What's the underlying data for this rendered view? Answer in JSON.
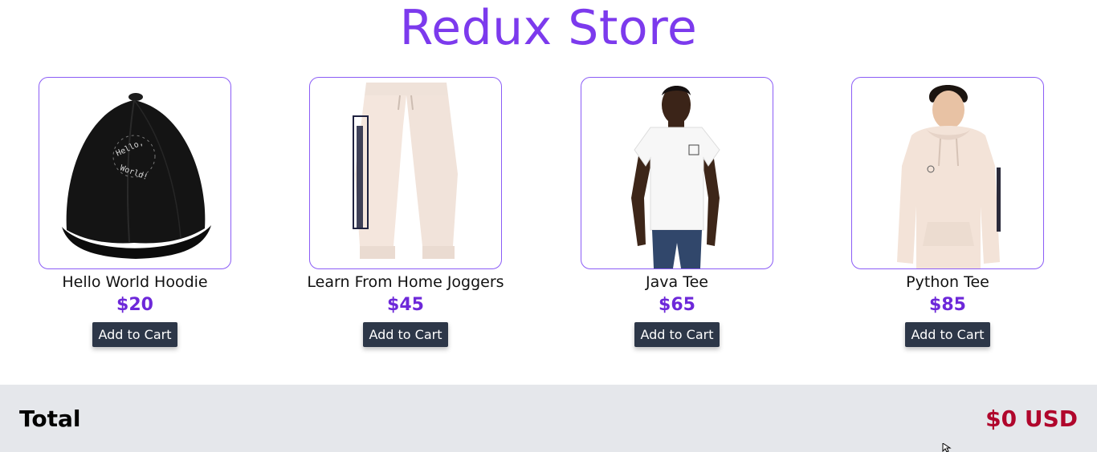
{
  "store": {
    "title": "Redux Store"
  },
  "products": [
    {
      "name": "Hello World Hoodie",
      "price": "$20",
      "button_label": "Add to Cart",
      "image": "black-cap-image"
    },
    {
      "name": "Learn From Home Joggers",
      "price": "$45",
      "button_label": "Add to Cart",
      "image": "cream-joggers-image"
    },
    {
      "name": "Java Tee",
      "price": "$65",
      "button_label": "Add to Cart",
      "image": "white-tee-model-image"
    },
    {
      "name": "Python Tee",
      "price": "$85",
      "button_label": "Add to Cart",
      "image": "cream-hoodie-model-image"
    }
  ],
  "cart": {
    "total_label": "Total",
    "total_value": "$0 USD"
  },
  "colors": {
    "accent": "#7c3aed",
    "price": "#6d28d9",
    "button_bg": "#2d3748",
    "total_value": "#b0062c",
    "footer_bg": "#e5e7eb"
  }
}
